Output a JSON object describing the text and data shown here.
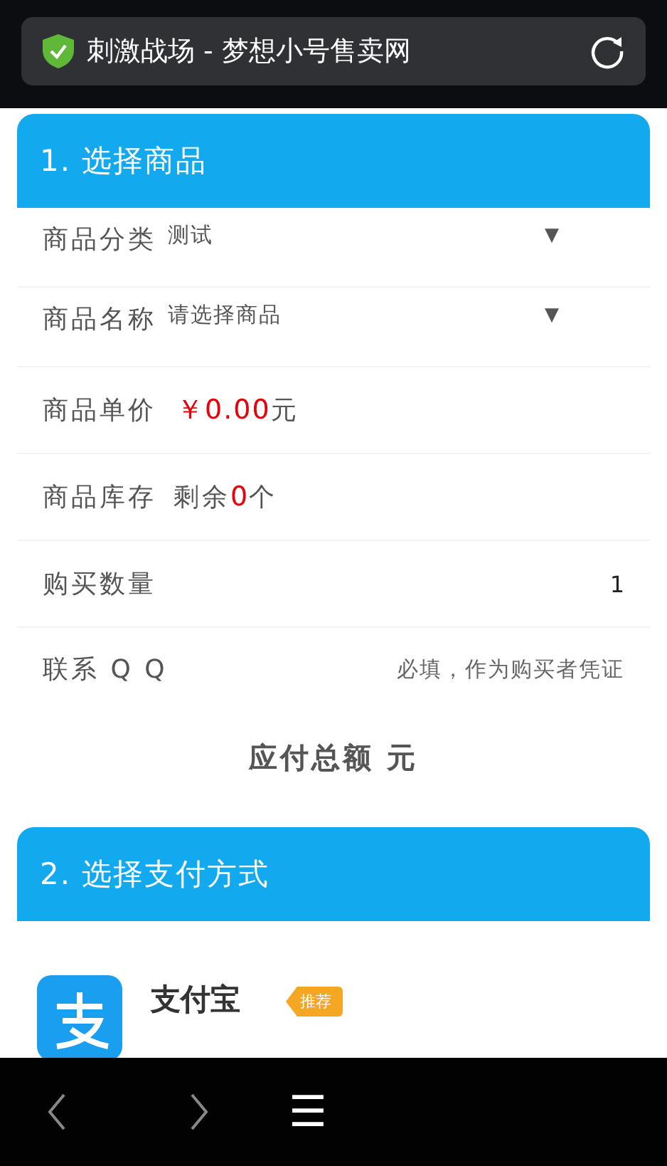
{
  "address_bar": {
    "secure": true,
    "title": "刺激战场 - 梦想小号售卖网"
  },
  "section_1": {
    "title": "1. 选择商品",
    "rows": [
      {
        "kind": "select",
        "label": "商品分类",
        "value": "测试",
        "arrow": "▼"
      },
      {
        "kind": "select",
        "label": "商品名称",
        "value": "请选择商品",
        "arrow": "▼"
      },
      {
        "kind": "price",
        "label": "商品单价",
        "currency": "￥",
        "amount": "0.00",
        "unit": "元"
      },
      {
        "kind": "stock",
        "label": "商品库存",
        "prefix": "剩余",
        "count": "0",
        "unit": "个"
      },
      {
        "kind": "number",
        "label": "购买数量",
        "value": "1"
      },
      {
        "kind": "input",
        "label": "联系 Q Q",
        "placeholder": "必填，作为购买者凭证"
      }
    ]
  },
  "total": {
    "label": "应付总额 元"
  },
  "section_2": {
    "title": "2. 选择支付方式",
    "methods": [
      {
        "name": "支付宝",
        "badge": "推荐"
      }
    ]
  },
  "nav_bar": {
    "menu_icon": "☰"
  }
}
